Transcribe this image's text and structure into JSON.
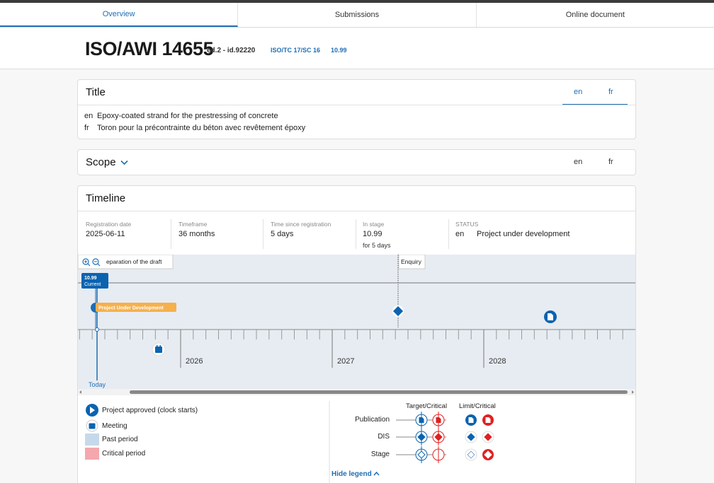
{
  "tabs": [
    "Overview",
    "Submissions",
    "Online document"
  ],
  "active_tab": "Overview",
  "header": {
    "doc_id": "ISO/AWI 14655",
    "edition": "ed.2 - id.92220",
    "committee": "ISO/TC 17/SC 16",
    "stage": "10.99"
  },
  "title_card": {
    "heading": "Title",
    "lang_en": "en",
    "lang_fr": "fr",
    "lines": [
      {
        "lang": "en",
        "text": "Epoxy-coated strand for the prestressing of concrete"
      },
      {
        "lang": "fr",
        "text": "Toron pour la précontrainte du béton avec revêtement époxy"
      }
    ]
  },
  "scope_card": {
    "heading": "Scope",
    "chevron": "chevron-down-icon",
    "lang_en": "en",
    "lang_fr": "fr"
  },
  "timeline": {
    "heading": "Timeline",
    "registration_label": "Registration date",
    "registration_value": "2025-06-11",
    "timeframe_label": "Timeframe",
    "timeframe_value": "36 months",
    "since_label": "Time since registration",
    "since_value": "5 days",
    "stage_label": "In stage",
    "stage_value": "10.99",
    "stage_sub": "for 5 days",
    "status_label": "STATUS",
    "status_lang": "en",
    "status_value": "Project under development",
    "phase_draft": "eparation of the draft",
    "phase_enquiry": "Enquiry",
    "current_code": "10.99",
    "current_label": "Current",
    "bar_label": "Project Under Development",
    "years": [
      "2026",
      "2027",
      "2028"
    ],
    "today": "Today",
    "colors": {
      "accent": "#1e6eb5",
      "current": "#0b63b0",
      "bar": "#f6b04c",
      "critical": "#e02020",
      "past": "#c6d9ea",
      "critical_fill": "#f4a7ad"
    }
  },
  "legend": {
    "approved": "Project approved (clock starts)",
    "meeting": "Meeting",
    "past": "Past period",
    "critical": "Critical period",
    "target_critical": "Target/Critical",
    "limit_critical": "Limit/Critical",
    "rows": [
      "Publication",
      "DIS",
      "Stage"
    ],
    "hide": "Hide legend"
  }
}
